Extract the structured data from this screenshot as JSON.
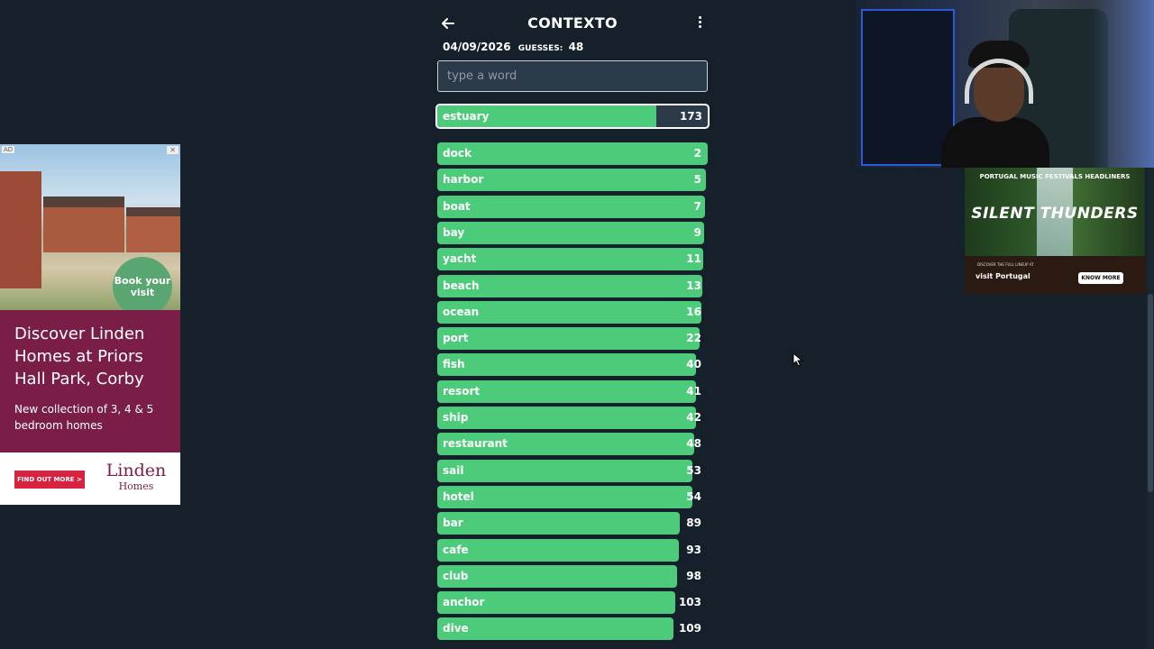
{
  "header": {
    "title": "CONTEXTO",
    "date": "04/09/2026",
    "guesses_label": "GUESSES:",
    "guesses_count": "48",
    "back_icon": "arrow-left-icon",
    "menu_icon": "more-vertical-icon"
  },
  "search": {
    "placeholder": "type a word"
  },
  "current_guess": {
    "word": "estuary",
    "rank": "173",
    "fill_fraction": 0.81
  },
  "guesses": [
    {
      "word": "dock",
      "rank": "2",
      "fill_fraction": 1.0
    },
    {
      "word": "harbor",
      "rank": "5",
      "fill_fraction": 0.993
    },
    {
      "word": "boat",
      "rank": "7",
      "fill_fraction": 0.99
    },
    {
      "word": "bay",
      "rank": "9",
      "fill_fraction": 0.987
    },
    {
      "word": "yacht",
      "rank": "11",
      "fill_fraction": 0.983
    },
    {
      "word": "beach",
      "rank": "13",
      "fill_fraction": 0.98
    },
    {
      "word": "ocean",
      "rank": "16",
      "fill_fraction": 0.977
    },
    {
      "word": "port",
      "rank": "22",
      "fill_fraction": 0.97
    },
    {
      "word": "fish",
      "rank": "40",
      "fill_fraction": 0.957
    },
    {
      "word": "resort",
      "rank": "41",
      "fill_fraction": 0.957
    },
    {
      "word": "ship",
      "rank": "42",
      "fill_fraction": 0.957
    },
    {
      "word": "restaurant",
      "rank": "48",
      "fill_fraction": 0.95
    },
    {
      "word": "sail",
      "rank": "53",
      "fill_fraction": 0.943
    },
    {
      "word": "hotel",
      "rank": "54",
      "fill_fraction": 0.943
    },
    {
      "word": "bar",
      "rank": "89",
      "fill_fraction": 0.897
    },
    {
      "word": "cafe",
      "rank": "93",
      "fill_fraction": 0.893
    },
    {
      "word": "club",
      "rank": "98",
      "fill_fraction": 0.887
    },
    {
      "word": "anchor",
      "rank": "103",
      "fill_fraction": 0.88
    },
    {
      "word": "dive",
      "rank": "109",
      "fill_fraction": 0.873
    }
  ],
  "ad_left": {
    "badge": "AD",
    "close": "✕",
    "circle_text": "Book your visit",
    "headline": "Discover Linden Homes at Priors Hall Park, Corby",
    "subtext": "New collection of 3, 4 & 5 bedroom homes",
    "cta": "FIND OUT MORE >",
    "logo_line1": "Linden",
    "logo_line2": "Homes"
  },
  "ad_right": {
    "top_text": "PORTUGAL MUSIC FESTIVALS HEADLINERS",
    "title": "SILENT THUNDERS",
    "discover": "DISCOVER THE FULL LINEUP AT",
    "brand": "visit Portugal",
    "cta": "KNOW MORE"
  },
  "colors": {
    "background": "#15202b",
    "bar": "#4ccb7a",
    "input_bg": "#2b3a48",
    "ad_brand": "#7a1e47",
    "ad_cta": "#d7233f"
  }
}
